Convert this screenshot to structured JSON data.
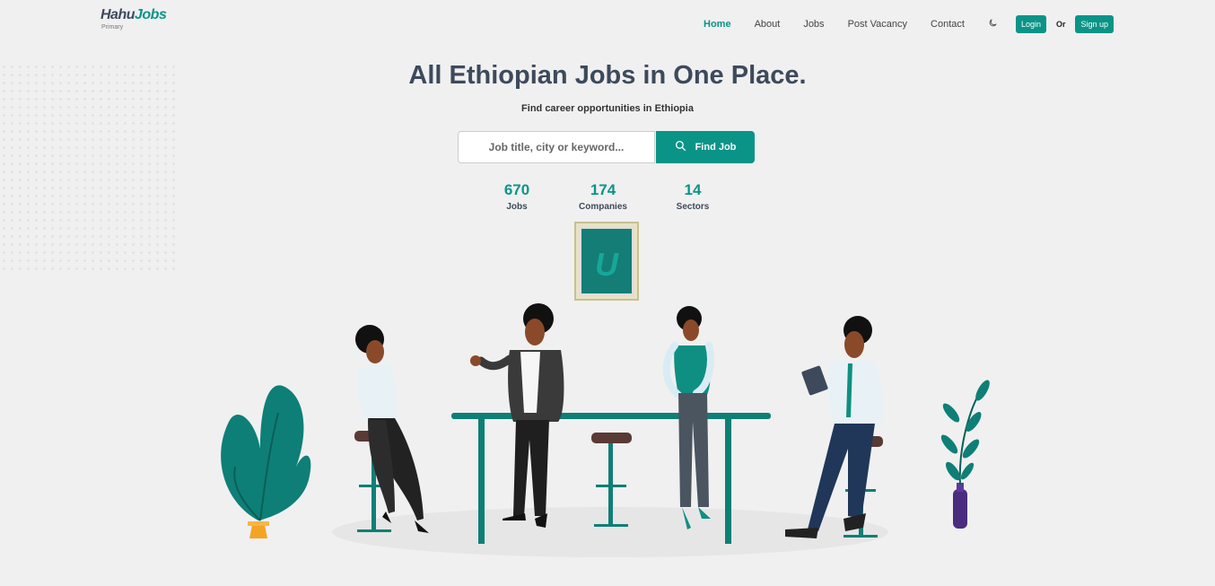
{
  "brand": {
    "name_part1": "Hahu",
    "name_part2": "Jobs",
    "subtitle": "Primary"
  },
  "nav": {
    "items": [
      {
        "label": "Home",
        "active": true
      },
      {
        "label": "About",
        "active": false
      },
      {
        "label": "Jobs",
        "active": false
      },
      {
        "label": "Post Vacancy",
        "active": false
      },
      {
        "label": "Contact",
        "active": false
      }
    ],
    "theme_icon": "moon-icon",
    "login_label": "Login",
    "or_label": "Or",
    "signup_label": "Sign up"
  },
  "hero": {
    "title": "All Ethiopian Jobs in One Place.",
    "subtitle": "Find career opportunities in Ethiopia"
  },
  "search": {
    "placeholder": "Job title, city or keyword...",
    "button_label": "Find Job",
    "button_icon": "search-icon"
  },
  "stats": [
    {
      "value": "670",
      "label": "Jobs"
    },
    {
      "value": "174",
      "label": "Companies"
    },
    {
      "value": "14",
      "label": "Sectors"
    }
  ],
  "colors": {
    "accent": "#0a9488",
    "text": "#3d4a5c",
    "background": "#f0f0f0"
  }
}
